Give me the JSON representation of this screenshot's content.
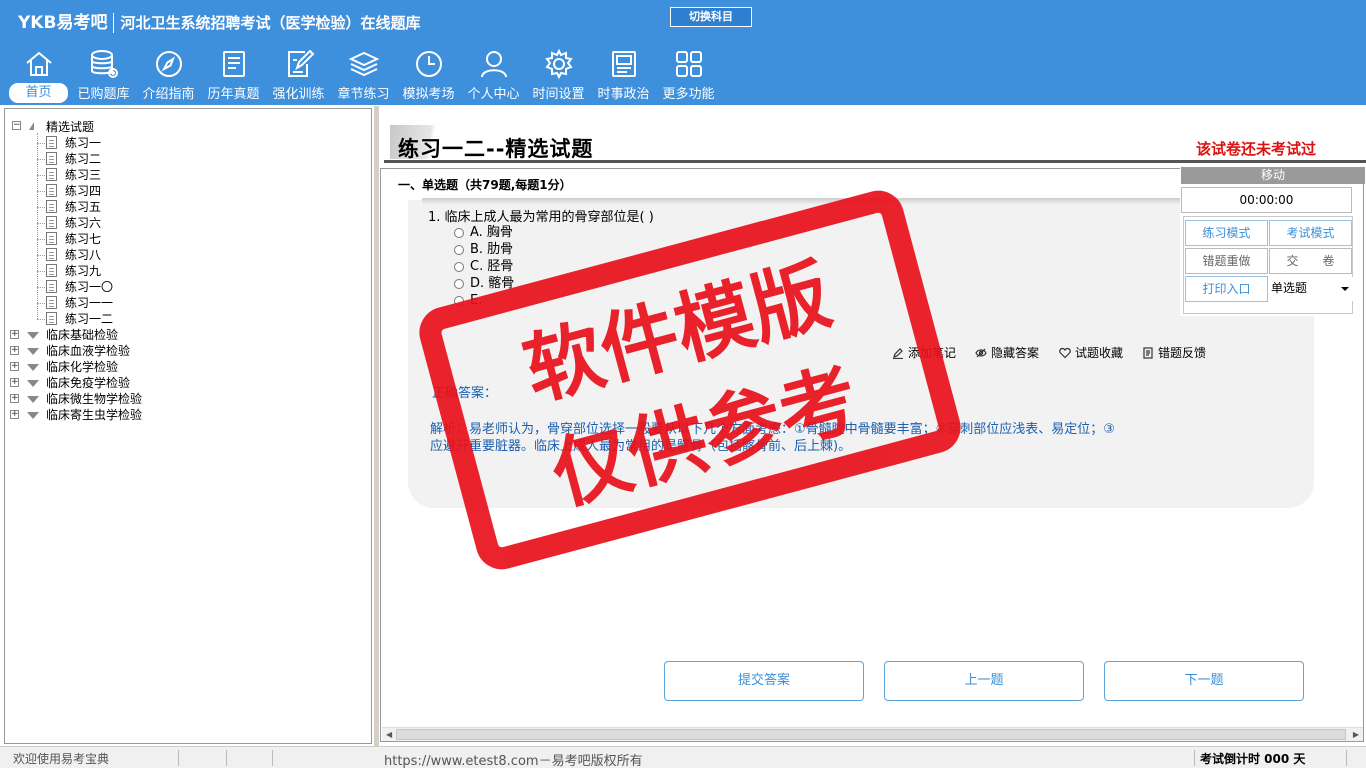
{
  "header": {
    "brand": "YKB易考吧",
    "title": "河北卫生系统招聘考试（医学检验）在线题库",
    "switch_label": "切换科目",
    "nav": [
      {
        "label": "首页",
        "icon": "home-icon"
      },
      {
        "label": "已购题库",
        "icon": "database-icon"
      },
      {
        "label": "介绍指南",
        "icon": "compass-icon"
      },
      {
        "label": "历年真题",
        "icon": "list-icon"
      },
      {
        "label": "强化训练",
        "icon": "edit-icon"
      },
      {
        "label": "章节练习",
        "icon": "layers-icon"
      },
      {
        "label": "模拟考场",
        "icon": "clock-icon"
      },
      {
        "label": "个人中心",
        "icon": "user-icon"
      },
      {
        "label": "时间设置",
        "icon": "gear-icon"
      },
      {
        "label": "时事政治",
        "icon": "news-icon"
      },
      {
        "label": "更多功能",
        "icon": "grid-icon"
      }
    ]
  },
  "tree": {
    "root": "精选试题",
    "leaves": [
      "练习一",
      "练习二",
      "练习三",
      "练习四",
      "练习五",
      "练习六",
      "练习七",
      "练习八",
      "练习九",
      "练习一〇",
      "练习一一",
      "练习一二"
    ],
    "groups": [
      "临床基础检验",
      "临床血液学检验",
      "临床化学检验",
      "临床免疫学检验",
      "临床微生物学检验",
      "临床寄生虫学检验"
    ]
  },
  "paper": {
    "title": "练习一二--精选试题",
    "status": "该试卷还未考试过",
    "section": "一、单选题（共79题,每题1分）"
  },
  "question": {
    "text": "1. 临床上成人最为常用的骨穿部位是( )",
    "options": [
      "A. 胸骨",
      "B. 肋骨",
      "C. 胫骨",
      "D. 髂骨",
      "E. "
    ],
    "answer_label": "正确答案：",
    "analysis_1": "解析：易老师认为，骨穿部位选择一般要从以下几个方面考虑：①骨髓腔中骨髓要丰富；②穿刺部位应浅表、易定位；③",
    "analysis_2": "应避开重要脏器。临床上成人最为常用的是髂骨（包括髂骨前、后上棘)。"
  },
  "tools": {
    "add_note": "添加笔记",
    "hide_answer": "隐藏答案",
    "favorite": "试题收藏",
    "feedback": "错题反馈"
  },
  "control": {
    "move_label": "移动",
    "timer": "00:00:00",
    "practice_mode": "练习模式",
    "exam_mode": "考试模式",
    "redo_wrong": "错题重做",
    "submit_paper": "交　　卷",
    "print": "打印入口",
    "type_select": "单选题"
  },
  "nav_buttons": {
    "submit": "提交答案",
    "prev": "上一题",
    "next": "下一题"
  },
  "status_bar": {
    "welcome": "欢迎使用易考宝典",
    "copyright": "https://www.etest8.com－易考吧版权所有",
    "countdown": "考试倒计时 000 天"
  },
  "watermark": {
    "line1": "软件模版",
    "line2": "仅供参考"
  },
  "colors": {
    "header_bg": "#3e8fdc",
    "accent": "#3a8fd8",
    "stamp": "#e8101a",
    "status_red": "#d11111"
  }
}
